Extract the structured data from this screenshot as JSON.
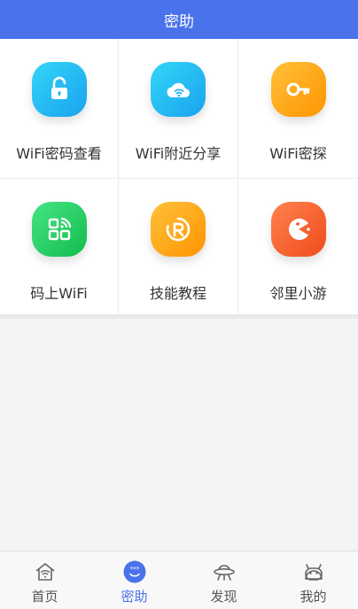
{
  "header": {
    "title": "密助"
  },
  "features": [
    {
      "label": "WiFi密码查看",
      "icon": "unlock-icon",
      "color_from": "#2fd0f5",
      "color_to": "#1aa8f0"
    },
    {
      "label": "WiFi附近分享",
      "icon": "cloud-wifi-icon",
      "color_from": "#2fd0f5",
      "color_to": "#1aa8f0"
    },
    {
      "label": "WiFi密探",
      "icon": "key-icon",
      "color_from": "#ffb52a",
      "color_to": "#ff9800"
    },
    {
      "label": "码上WiFi",
      "icon": "qr-code-icon",
      "color_from": "#3fe07a",
      "color_to": "#18c152"
    },
    {
      "label": "技能教程",
      "icon": "tutorial-r-icon",
      "color_from": "#ffb52a",
      "color_to": "#ff9800"
    },
    {
      "label": "邻里小游",
      "icon": "pacman-game-icon",
      "color_from": "#ff7a45",
      "color_to": "#f2521f"
    }
  ],
  "tabs": [
    {
      "label": "首页",
      "icon": "home-wifi-icon",
      "active": false
    },
    {
      "label": "密助",
      "icon": "password-face-icon",
      "active": true
    },
    {
      "label": "发现",
      "icon": "ufo-discover-icon",
      "active": false
    },
    {
      "label": "我的",
      "icon": "android-face-icon",
      "active": false
    }
  ],
  "colors": {
    "accent": "#4a73eb",
    "tab_inactive": "#555555"
  }
}
